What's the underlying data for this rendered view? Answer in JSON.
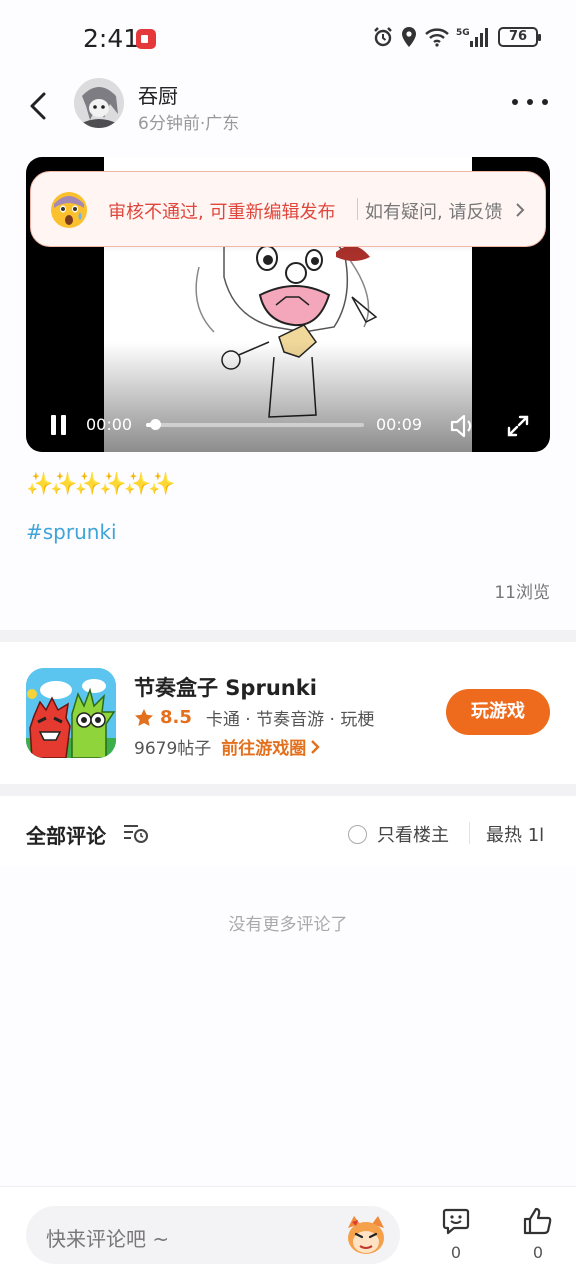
{
  "status_bar": {
    "time": "2:41",
    "network": "5G",
    "battery": "76"
  },
  "header": {
    "author": "吞厨",
    "meta": "6分钟前·广东"
  },
  "video": {
    "current_time": "00:00",
    "total_time": "00:09",
    "progress": 0.04
  },
  "review_banner": {
    "status_text": "审核不通过, 可重新编辑发布",
    "feedback_text": "如有疑问, 请反馈"
  },
  "post": {
    "sparkles": "✨✨✨✨✨✨",
    "hashtag": "#sprunki",
    "views": "11浏览"
  },
  "game": {
    "title": "节奏盒子 Sprunki",
    "rating": "8.5",
    "tags": "卡通 · 节奏音游 · 玩梗",
    "post_count": "9679帖子",
    "circle_link": "前往游戏圈",
    "play_button": "玩游戏"
  },
  "comments": {
    "title": "全部评论",
    "only_host": "只看楼主",
    "sort": "最热 1l",
    "empty_text": "没有更多评论了"
  },
  "bottom_bar": {
    "placeholder": "快来评论吧 ~",
    "comment_count": "0",
    "like_count": "0"
  },
  "colors": {
    "accent": "#ee6b1e",
    "rejection": "#e0473c",
    "hashtag": "#3fa5d8"
  }
}
